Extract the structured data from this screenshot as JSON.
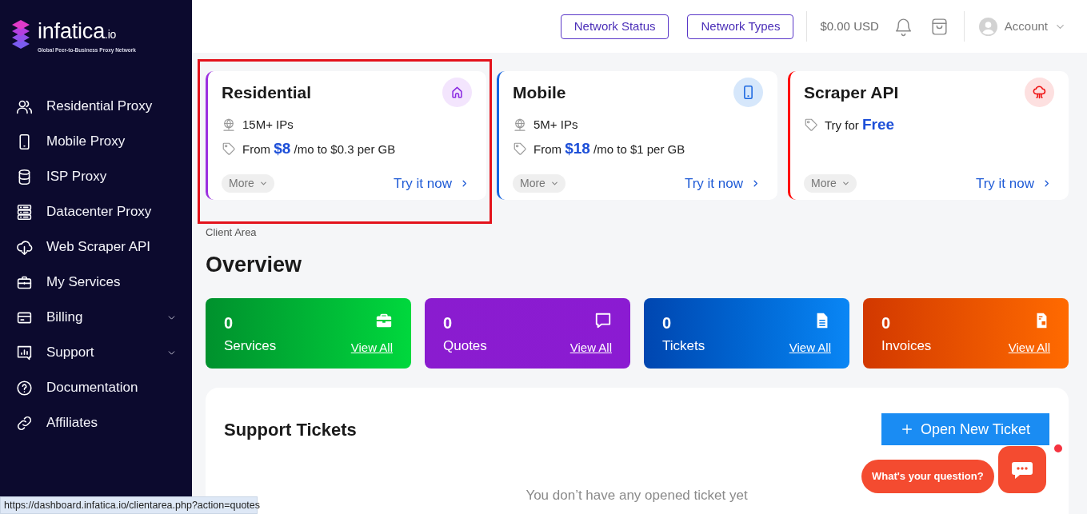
{
  "sidebar": {
    "logo": {
      "wordmark": "infatica",
      "suffix": ".io",
      "tagline": "Global Peer-to-Business Proxy Network"
    },
    "items": [
      {
        "label": "Residential Proxy",
        "has_submenu": false
      },
      {
        "label": "Mobile Proxy",
        "has_submenu": false
      },
      {
        "label": "ISP Proxy",
        "has_submenu": false
      },
      {
        "label": "Datacenter Proxy",
        "has_submenu": false
      },
      {
        "label": "Web Scraper API",
        "has_submenu": false
      },
      {
        "label": "My Services",
        "has_submenu": false
      },
      {
        "label": "Billing",
        "has_submenu": true
      },
      {
        "label": "Support",
        "has_submenu": true
      },
      {
        "label": "Documentation",
        "has_submenu": false
      },
      {
        "label": "Affiliates",
        "has_submenu": false
      }
    ]
  },
  "header": {
    "buttons": [
      "Network Status",
      "Network Types"
    ],
    "balance": "$0.00 USD",
    "account": "Account"
  },
  "products": [
    {
      "title": "Residential",
      "highlighted": true,
      "features": [
        {
          "kind": "ips",
          "text": "15M+ IPs"
        },
        {
          "kind": "price",
          "text": "From **$8** /mo to $0.3 per GB"
        }
      ],
      "more": "More",
      "cta": "Try it now"
    },
    {
      "title": "Mobile",
      "highlighted": false,
      "features": [
        {
          "kind": "ips",
          "text": "5M+ IPs"
        },
        {
          "kind": "price",
          "text": "From **$18** /mo to $1 per GB"
        }
      ],
      "more": "More",
      "cta": "Try it now"
    },
    {
      "title": "Scraper API",
      "highlighted": false,
      "features": [
        {
          "kind": "price",
          "text": "Try for **Free**"
        }
      ],
      "more": "More",
      "cta": "Try it now"
    }
  ],
  "breadcrumb": "Client Area",
  "heading": "Overview",
  "stats": [
    {
      "count": "0",
      "label": "Services",
      "link": "View All"
    },
    {
      "count": "0",
      "label": "Quotes",
      "link": "View All"
    },
    {
      "count": "0",
      "label": "Tickets",
      "link": "View All"
    },
    {
      "count": "0",
      "label": "Invoices",
      "link": "View All"
    }
  ],
  "support_tickets": {
    "title": "Support Tickets",
    "button": "Open New Ticket",
    "empty_message": "You don’t have any opened ticket yet"
  },
  "chat": {
    "prompt": "What's your question?",
    "unread": true
  },
  "status_bar": {
    "url": "https://dashboard.infatica.io/clientarea.php?action=quotes"
  }
}
